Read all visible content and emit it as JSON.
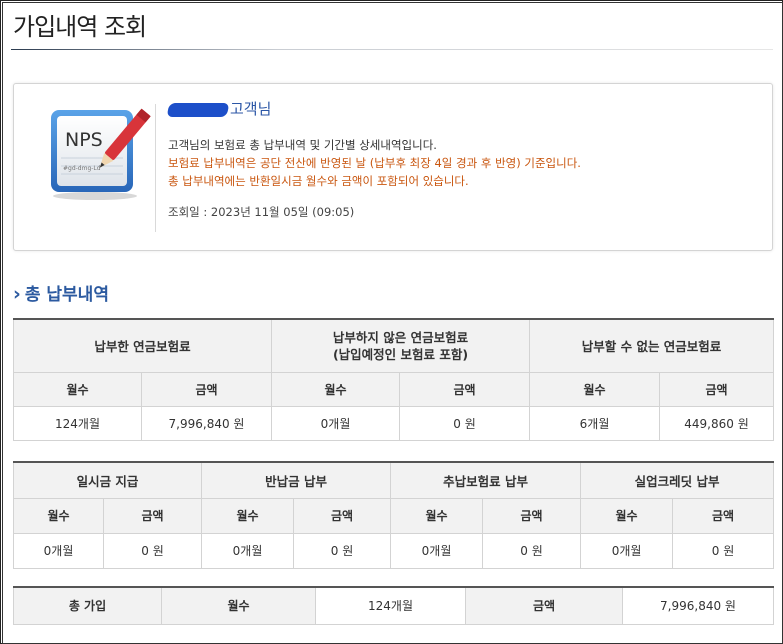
{
  "page": {
    "title": "가입내역 조회"
  },
  "info": {
    "customer_suffix": "고객님",
    "lines": [
      "고객님의 보험료 총 납부내역 및 기간별 상세내역입니다.",
      "보험료 납부내역은 공단 전산에 반영된 날 (납부후 최장 4일 경과 후 반영) 기준입니다.",
      "총 납부내역에는 반환일시금 월수와 금액이 포함되어 있습니다."
    ],
    "date": "조회일 : 2023년 11월 05일 (09:05)",
    "icon_text": "NPS",
    "icon_subtext": "#gd-dmg-Ld"
  },
  "section": {
    "title": "총 납부내역"
  },
  "table1": {
    "groups": [
      "납부한 연금보험료",
      "납부하지 않은 연금보험료\n(납입예정인 보험료 포함)",
      "납부할 수 없는 연금보험료"
    ],
    "sub": [
      "월수",
      "금액",
      "월수",
      "금액",
      "월수",
      "금액"
    ],
    "row": [
      "124개월",
      "7,996,840 원",
      "0개월",
      "0 원",
      "6개월",
      "449,860 원"
    ]
  },
  "table2": {
    "groups": [
      "일시금 지급",
      "반납금 납부",
      "추납보험료 납부",
      "실업크레딧 납부"
    ],
    "sub": [
      "월수",
      "금액",
      "월수",
      "금액",
      "월수",
      "금액",
      "월수",
      "금액"
    ],
    "row": [
      "0개월",
      "0 원",
      "0개월",
      "0 원",
      "0개월",
      "0 원",
      "0개월",
      "0 원"
    ]
  },
  "table3": {
    "label": "총 가입",
    "months_label": "월수",
    "months": "124개월",
    "amount_label": "금액",
    "amount": "7,996,840 원"
  }
}
